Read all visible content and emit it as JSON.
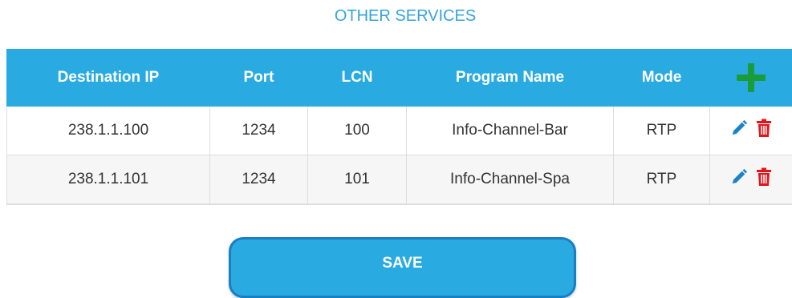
{
  "title": "OTHER SERVICES",
  "table": {
    "headers": {
      "destination_ip": "Destination IP",
      "port": "Port",
      "lcn": "LCN",
      "program_name": "Program Name",
      "mode": "Mode"
    },
    "add_icon": "plus-icon",
    "rows": [
      {
        "destination_ip": "238.1.1.100",
        "port": "1234",
        "lcn": "100",
        "program_name": "Info-Channel-Bar",
        "mode": "RTP"
      },
      {
        "destination_ip": "238.1.1.101",
        "port": "1234",
        "lcn": "101",
        "program_name": "Info-Channel-Spa",
        "mode": "RTP"
      }
    ],
    "row_actions": {
      "edit_icon": "pencil-icon",
      "delete_icon": "trash-icon"
    }
  },
  "save_label": "SAVE",
  "colors": {
    "header_bg": "#29abe2",
    "title": "#35a4de",
    "add": "#1b9c3a",
    "edit": "#1d82c6",
    "delete": "#e0161c",
    "button_border": "#1a7ec2"
  }
}
